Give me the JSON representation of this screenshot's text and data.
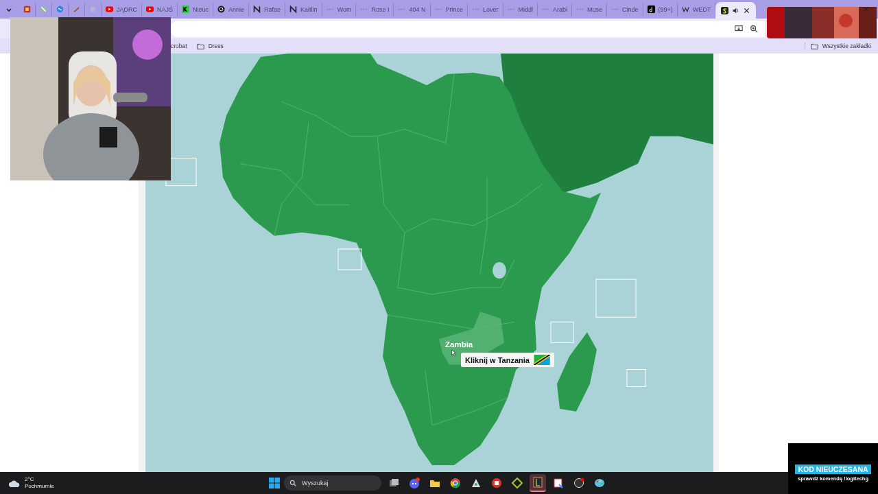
{
  "tabs": [
    {
      "kind": "tile",
      "selected": false
    },
    {
      "kind": "fan",
      "selected": false
    },
    {
      "kind": "loop",
      "selected": false
    },
    {
      "kind": "pen",
      "selected": false
    },
    {
      "kind": "dot",
      "selected": false
    },
    {
      "label": "JĄDRC",
      "kind": "play",
      "selected": false
    },
    {
      "label": "NAJŚ",
      "kind": "play",
      "selected": false
    },
    {
      "label": "Nieuc",
      "kind": "k",
      "selected": false
    },
    {
      "label": "Annie",
      "kind": "round",
      "selected": false
    },
    {
      "label": "Rafae",
      "kind": "n",
      "selected": false
    },
    {
      "label": "Kaitlin",
      "kind": "n",
      "selected": false
    },
    {
      "label": "Wom",
      "kind": "dash",
      "selected": false
    },
    {
      "label": "Rose I",
      "kind": "dash",
      "selected": false
    },
    {
      "label": "404 N",
      "kind": "dash",
      "selected": false
    },
    {
      "label": "Prince",
      "kind": "dash",
      "selected": false
    },
    {
      "label": "Lover",
      "kind": "dash",
      "selected": false
    },
    {
      "label": "Middl",
      "kind": "dash",
      "selected": false
    },
    {
      "label": "Arabi",
      "kind": "dash",
      "selected": false
    },
    {
      "label": "Muse",
      "kind": "dash",
      "selected": false
    },
    {
      "label": "Cinde",
      "kind": "dash",
      "selected": false
    },
    {
      "label": "(99+)",
      "kind": "note",
      "selected": false
    },
    {
      "label": "WEDT",
      "kind": "w",
      "selected": false
    },
    {
      "kind": "s",
      "selected": true,
      "audio": true
    }
  ],
  "bookmarks": [
    {
      "label": "crobat"
    },
    {
      "label": "Dress"
    }
  ],
  "all_bookmarks": "Wszystkie zakładki",
  "map": {
    "hover_label": "Zambia",
    "prompt": "Kliknij w Tanzania"
  },
  "taskbar": {
    "temperature": "2°C",
    "weather": "Pochmurnie",
    "search_placeholder": "Wyszukaj"
  },
  "overlay": {
    "code": "KOD NIEUCZESANA",
    "hint": "sprawdź komendę !logitechg"
  }
}
